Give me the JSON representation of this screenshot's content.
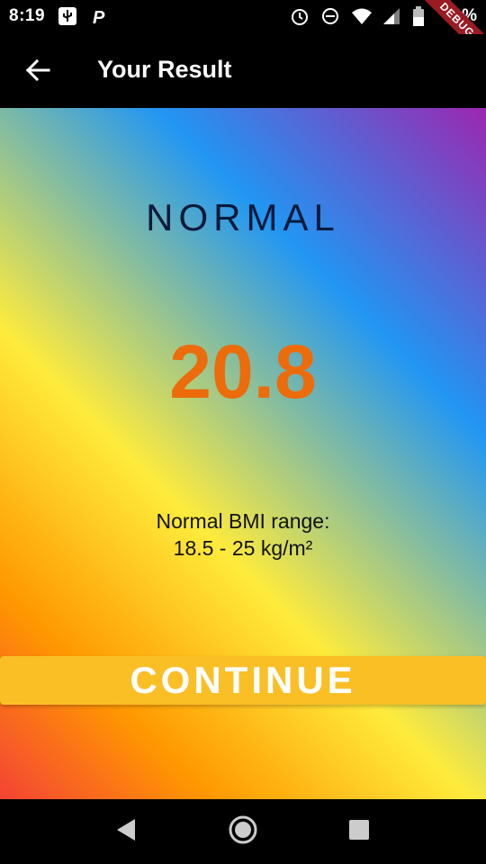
{
  "status_bar": {
    "time": "8:19",
    "battery": "50%",
    "icons": [
      "usb-icon",
      "parking-icon",
      "alarm-icon",
      "dnd-icon",
      "wifi-icon",
      "signal-icon",
      "battery-icon"
    ]
  },
  "debug_banner": "DEBUG",
  "app_bar": {
    "title": "Your Result",
    "back_icon": "arrow-back-icon"
  },
  "result": {
    "label": "NORMAL",
    "bmi": "20.8",
    "range_title": "Normal BMI range:",
    "range_value": "18.5 - 25 kg/m²"
  },
  "button": {
    "continue_label": "CONTINUE"
  },
  "colors": {
    "bmi_value": "#ec6b0b",
    "button": "#fbbf26",
    "label": "#0b1a3a"
  },
  "nav_bar": {
    "items": [
      "back-triangle-icon",
      "home-circle-icon",
      "recents-square-icon"
    ]
  }
}
